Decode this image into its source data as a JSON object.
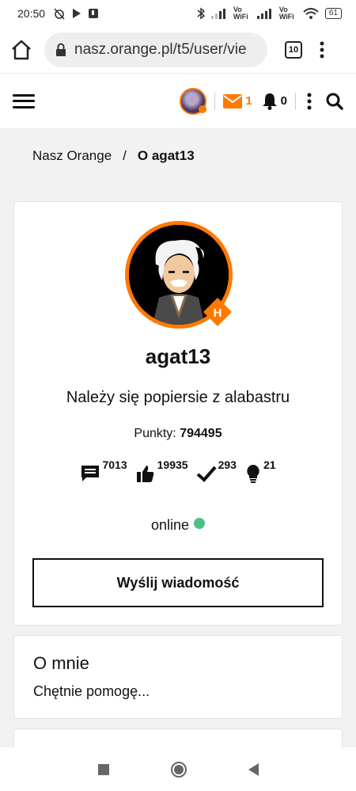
{
  "status_bar": {
    "time": "20:50",
    "battery": "61",
    "wifi_label_1": "Vo WiFi",
    "wifi_label_2": "Vo WiFi"
  },
  "browser": {
    "url": "nasz.orange.pl/t5/user/vie",
    "tab_count": "10"
  },
  "header": {
    "messages_count": "1",
    "notifications_count": "0"
  },
  "breadcrumb": {
    "home": "Nasz Orange",
    "separator": "/",
    "current": "O agat13"
  },
  "profile": {
    "rank_badge_letter": "H",
    "username": "agat13",
    "rank_title": "Należy się popiersie z alabastru",
    "points_label": "Punkty:",
    "points_value": "794495",
    "stats": {
      "posts": "7013",
      "kudos": "19935",
      "solutions": "293",
      "ideas": "21"
    },
    "status": "online",
    "send_message_label": "Wyślij wiadomość"
  },
  "about": {
    "title": "O mnie",
    "text": "Chętnie pomogę..."
  },
  "colors": {
    "brand": "#ff7900",
    "online": "#50be87"
  }
}
